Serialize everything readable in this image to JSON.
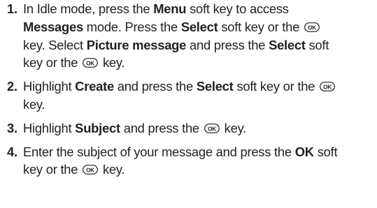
{
  "keys": {
    "ok": "OK"
  },
  "steps": [
    {
      "number": "1.",
      "lines": [
        [
          {
            "text": "In Idle mode, press the ",
            "bold": false
          },
          {
            "text": "Menu",
            "bold": true
          },
          {
            "text": " soft key to access",
            "bold": false
          }
        ],
        [
          {
            "text": "Messages",
            "bold": true
          },
          {
            "text": " mode. Press the ",
            "bold": false
          },
          {
            "text": "Select",
            "bold": true
          },
          {
            "text": " soft key or the ",
            "bold": false
          },
          {
            "key": "ok"
          }
        ],
        [
          {
            "text": "key. Select ",
            "bold": false
          },
          {
            "text": "Picture message",
            "bold": true
          },
          {
            "text": " and press the ",
            "bold": false
          },
          {
            "text": "Select",
            "bold": true
          },
          {
            "text": " soft",
            "bold": false
          }
        ],
        [
          {
            "text": "key or the ",
            "bold": false
          },
          {
            "key": "ok"
          },
          {
            "text": " key.",
            "bold": false
          }
        ]
      ]
    },
    {
      "number": "2.",
      "lines": [
        [
          {
            "text": "Highlight ",
            "bold": false
          },
          {
            "text": "Create",
            "bold": true
          },
          {
            "text": " and press the ",
            "bold": false
          },
          {
            "text": "Select",
            "bold": true
          },
          {
            "text": " soft key or the ",
            "bold": false
          },
          {
            "key": "ok"
          }
        ],
        [
          {
            "text": "key.",
            "bold": false
          }
        ]
      ]
    },
    {
      "number": "3.",
      "lines": [
        [
          {
            "text": "Highlight ",
            "bold": false
          },
          {
            "text": "Subject",
            "bold": true
          },
          {
            "text": " and press the ",
            "bold": false
          },
          {
            "key": "ok"
          },
          {
            "text": " key.",
            "bold": false
          }
        ]
      ]
    },
    {
      "number": "4.",
      "lines": [
        [
          {
            "text": "Enter the subject of your message and press the ",
            "bold": false
          },
          {
            "text": "OK",
            "bold": true
          },
          {
            "text": " soft",
            "bold": false
          }
        ],
        [
          {
            "text": "key or the ",
            "bold": false
          },
          {
            "key": "ok"
          },
          {
            "text": " key.",
            "bold": false
          }
        ]
      ]
    }
  ]
}
